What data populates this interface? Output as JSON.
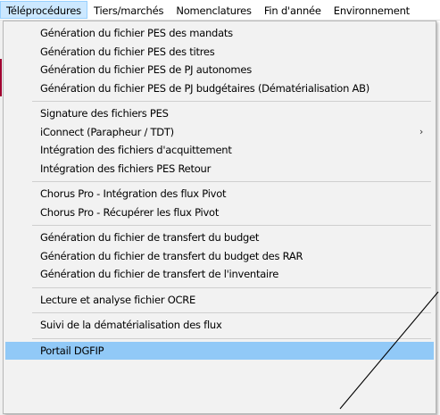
{
  "menubar": {
    "items": [
      {
        "label": "Téléprocédures",
        "active": true
      },
      {
        "label": "Tiers/marchés",
        "active": false
      },
      {
        "label": "Nomenclatures",
        "active": false
      },
      {
        "label": "Fin d'année",
        "active": false
      },
      {
        "label": "Environnement",
        "active": false
      }
    ]
  },
  "dropdown": {
    "groups": [
      [
        "Génération du fichier PES des mandats",
        "Génération du fichier PES des titres",
        "Génération du fichier PES de PJ autonomes",
        "Génération du fichier PES de PJ budgétaires (Dématérialisation AB)"
      ],
      [
        "Signature des fichiers PES",
        "iConnect (Parapheur / TDT)",
        "Intégration des fichiers d'acquittement",
        "Intégration des fichiers PES Retour"
      ],
      [
        "Chorus Pro - Intégration des flux Pivot",
        "Chorus Pro - Récupérer les flux Pivot"
      ],
      [
        "Génération du fichier de transfert du budget",
        "Génération du fichier de transfert du budget des RAR",
        "Génération du fichier de transfert de l'inventaire"
      ],
      [
        "Lecture et analyse fichier OCRE"
      ],
      [
        "Suivi de la dématérialisation des flux"
      ],
      [
        "Portail DGFIP"
      ]
    ],
    "submenu_item": "iConnect (Parapheur / TDT)",
    "highlighted_item": "Portail DGFIP",
    "submenu_arrow": "›"
  },
  "colors": {
    "menubar_active_bg": "#cce8ff",
    "highlight_bg": "#91c9f7",
    "menu_bg": "#f2f2f2"
  }
}
